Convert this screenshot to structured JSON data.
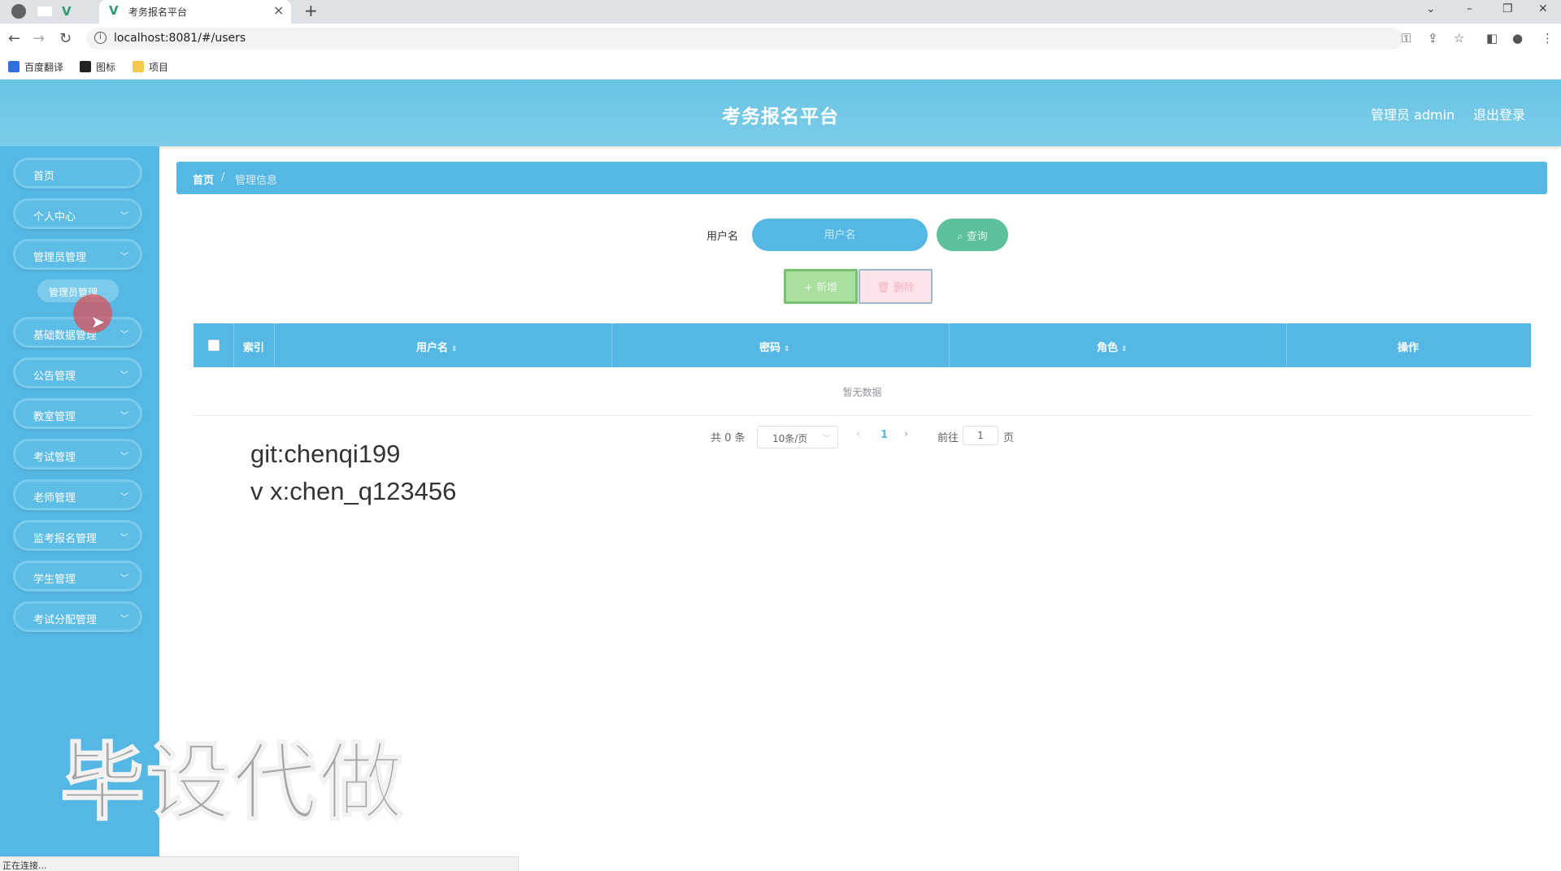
{
  "browser": {
    "tab_title": "考务报名平台",
    "url": "localhost:8081/#/users",
    "bookmarks": [
      {
        "label": "百度翻译",
        "icon": "translate-icon"
      },
      {
        "label": "图标",
        "icon": "image-icon"
      },
      {
        "label": "项目",
        "icon": "folder-icon"
      }
    ],
    "status": "正在连接..."
  },
  "header": {
    "title": "考务报名平台",
    "user_label": "管理员 admin",
    "logout_label": "退出登录"
  },
  "sidebar": {
    "items": [
      {
        "label": "首页",
        "has_chevron": false
      },
      {
        "label": "个人中心",
        "has_chevron": true
      },
      {
        "label": "管理员管理",
        "has_chevron": true
      },
      {
        "label": "基础数据管理",
        "has_chevron": true
      },
      {
        "label": "公告管理",
        "has_chevron": true
      },
      {
        "label": "教室管理",
        "has_chevron": true
      },
      {
        "label": "考试管理",
        "has_chevron": true
      },
      {
        "label": "老师管理",
        "has_chevron": true
      },
      {
        "label": "监考报名管理",
        "has_chevron": true
      },
      {
        "label": "学生管理",
        "has_chevron": true
      },
      {
        "label": "考试分配管理",
        "has_chevron": true
      }
    ],
    "subitem": "管理员管理"
  },
  "breadcrumb": {
    "home": "首页",
    "separator": "/",
    "current": "管理信息"
  },
  "search": {
    "label": "用户名",
    "placeholder": "用户名",
    "query_button": "查询"
  },
  "actions": {
    "add_button": "新增",
    "delete_button": "删除"
  },
  "table": {
    "columns": [
      {
        "label": "索引",
        "sortable": false
      },
      {
        "label": "用户名",
        "sortable": true
      },
      {
        "label": "密码",
        "sortable": true
      },
      {
        "label": "角色",
        "sortable": true
      },
      {
        "label": "操作",
        "sortable": false
      }
    ],
    "empty_text": "暂无数据"
  },
  "pagination": {
    "total": "共 0 条",
    "page_size": "10条/页",
    "current_page": "1",
    "goto_label": "前往",
    "goto_value": "1",
    "page_unit": "页"
  },
  "overlay": {
    "line1": "git:chenqi199",
    "line2": "v x:chen_q123456",
    "watermark": "毕设代做"
  },
  "colors": {
    "primary": "#55b8e4",
    "header_bg": "#6fc7e6",
    "query_green": "#5cc09a",
    "add_green": "#a9df9f",
    "delete_pink": "#fde4ea"
  }
}
